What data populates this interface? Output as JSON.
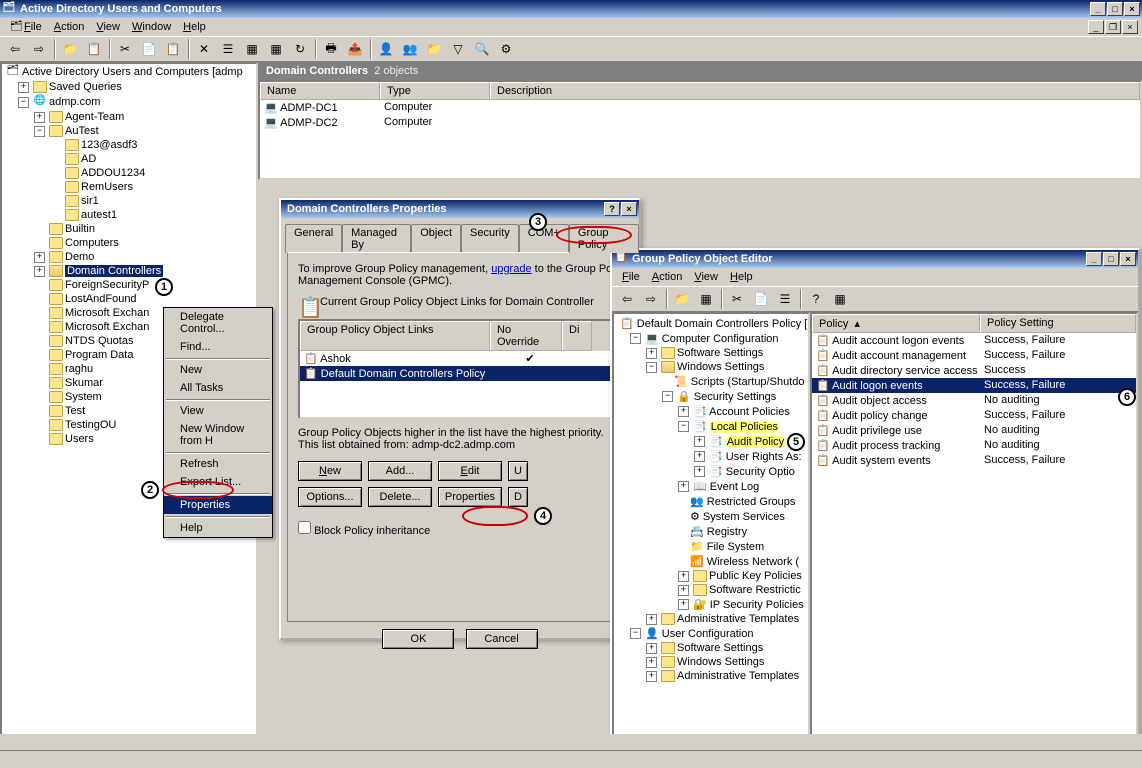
{
  "main_window": {
    "title": "Active Directory Users and Computers",
    "menus": [
      "File",
      "Action",
      "View",
      "Window",
      "Help"
    ]
  },
  "content": {
    "header_title": "Domain Controllers",
    "header_count": "2 objects",
    "cols": {
      "name": "Name",
      "type": "Type",
      "desc": "Description"
    },
    "rows": [
      {
        "name": "ADMP-DC1",
        "type": "Computer"
      },
      {
        "name": "ADMP-DC2",
        "type": "Computer"
      }
    ]
  },
  "tree": {
    "root": "Active Directory Users and Computers [admp",
    "saved": "Saved Queries",
    "domain": "admp.com",
    "items": [
      "Agent-Team",
      "AuTest",
      "123@asdf3",
      "AD",
      "ADDOU1234",
      "RemUsers",
      "sir1",
      "autest1",
      "Builtin",
      "Computers",
      "Demo",
      "Domain Controllers",
      "ForeignSecurityP",
      "LostAndFound",
      "Microsoft Exchan",
      "Microsoft Exchan",
      "NTDS Quotas",
      "Program Data",
      "raghu",
      "Skumar",
      "System",
      "Test",
      "TestingOU",
      "Users"
    ]
  },
  "ctx": {
    "items": [
      "Delegate Control...",
      "Find...",
      "New",
      "All Tasks",
      "View",
      "New Window from H",
      "Refresh",
      "Export List...",
      "Properties",
      "Help"
    ]
  },
  "props": {
    "title": "Domain Controllers Properties",
    "tabs": [
      "General",
      "Managed By",
      "Object",
      "Security",
      "COM+",
      "Group Policy"
    ],
    "body1a": "To improve Group Policy management, ",
    "body1link": "upgrade",
    "body1b": " to the Group Poli",
    "body2": "Management Console (GPMC).",
    "body3": "Current Group Policy Object Links for Domain Controller",
    "list_hdr": {
      "links": "Group Policy Object Links",
      "noover": "No Override",
      "di": "Di"
    },
    "list_rows": [
      {
        "name": "Ashok",
        "noover": "✔"
      },
      {
        "name": "Default Domain Controllers Policy",
        "noover": ""
      }
    ],
    "note1": "Group Policy Objects higher in the list have the highest priority.",
    "note2": "This list obtained from: admp-dc2.admp.com",
    "btns": {
      "new": "New",
      "add": "Add...",
      "edit": "Edit",
      "u": "U",
      "options": "Options...",
      "delete": "Delete...",
      "properties": "Properties",
      "d": "D"
    },
    "block": "Block Policy inheritance",
    "ok": "OK",
    "cancel": "Cancel"
  },
  "gpe": {
    "title": "Group Policy Object Editor",
    "menus": [
      "File",
      "Action",
      "View",
      "Help"
    ],
    "tree": {
      "root": "Default Domain Controllers Policy [",
      "cc": "Computer Configuration",
      "ss": "Software Settings",
      "ws": "Windows Settings",
      "scripts": "Scripts (Startup/Shutdo",
      "sec": "Security Settings",
      "ap": "Account Policies",
      "lp": "Local Policies",
      "audit": "Audit Policy",
      "ura": "User Rights As:",
      "so": "Security Optio",
      "el": "Event Log",
      "rg": "Restricted Groups",
      "sysserv": "System Services",
      "reg": "Registry",
      "fs": "File System",
      "wn": "Wireless Network (",
      "pkp": "Public Key Policies",
      "srp": "Software Restrictic",
      "ipsec": "IP Security Policies",
      "at": "Administrative Templates",
      "uc": "User Configuration",
      "ss2": "Software Settings",
      "ws2": "Windows Settings",
      "at2": "Administrative Templates"
    },
    "pol_hdr": {
      "policy": "Policy",
      "setting": "Policy Setting"
    },
    "policies": [
      {
        "name": "Audit account logon events",
        "val": "Success, Failure"
      },
      {
        "name": "Audit account management",
        "val": "Success, Failure"
      },
      {
        "name": "Audit directory service access",
        "val": "Success"
      },
      {
        "name": "Audit logon events",
        "val": "Success, Failure",
        "sel": true
      },
      {
        "name": "Audit object access",
        "val": "No auditing"
      },
      {
        "name": "Audit policy change",
        "val": "Success, Failure"
      },
      {
        "name": "Audit privilege use",
        "val": "No auditing"
      },
      {
        "name": "Audit process tracking",
        "val": "No auditing"
      },
      {
        "name": "Audit system events",
        "val": "Success, Failure"
      }
    ]
  },
  "steps": [
    "1",
    "2",
    "3",
    "4",
    "5",
    "6"
  ]
}
